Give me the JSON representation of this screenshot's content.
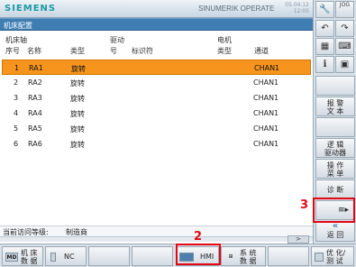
{
  "header": {
    "brand": "SIEMENS",
    "product": "SINUMERIK OPERATE",
    "date": "05.04.12",
    "time": "12:05"
  },
  "title": "机床配置",
  "table": {
    "header_row1": {
      "axis": "机床轴",
      "drive": "驱动",
      "motor": "电机"
    },
    "header_row2": {
      "no": "序号",
      "name": "名称",
      "type": "类型",
      "drive_no": "号",
      "drive_id": "标识符",
      "motor_type": "类型",
      "channel": "通道"
    },
    "rows": [
      {
        "no": "1",
        "name": "RA1",
        "type": "旋转",
        "channel": "CHAN1"
      },
      {
        "no": "2",
        "name": "RA2",
        "type": "旋转",
        "channel": "CHAN1"
      },
      {
        "no": "3",
        "name": "RA3",
        "type": "旋转",
        "channel": "CHAN1"
      },
      {
        "no": "4",
        "name": "RA4",
        "type": "旋转",
        "channel": "CHAN1"
      },
      {
        "no": "5",
        "name": "RA5",
        "type": "旋转",
        "channel": "CHAN1"
      },
      {
        "no": "6",
        "name": "RA6",
        "type": "旋转",
        "channel": "CHAN1"
      }
    ]
  },
  "status": {
    "access_label": "当前访问等级:",
    "access_value": "制造商"
  },
  "hsoftkeys": {
    "md_icon": "MD",
    "machine_data": "机 床\n数 据",
    "nc": "NC",
    "hmi": "HMI",
    "system_data": "系 统\n数 据",
    "optimize": "优 化/\n测 试"
  },
  "vsoftkeys": {
    "alarm_text": "报 警\n文 本",
    "logical_drive": "逻 辑\n驱动器",
    "operator_menu": "操 作\n菜 单",
    "diagnosis": "诊 断",
    "back_arrows": "«",
    "back": "返 回"
  },
  "annotations": {
    "marker2": "2",
    "marker3": "3"
  },
  "colors": {
    "selected_row": "#f7941e",
    "title_bar": "#3f7eb3",
    "annotation": "#e30613"
  }
}
